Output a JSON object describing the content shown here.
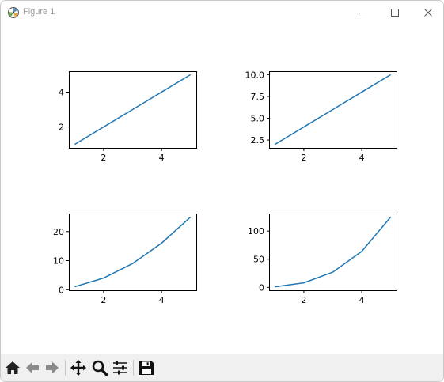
{
  "window": {
    "title": "Figure 1",
    "minimize_icon": "minimize-icon",
    "maximize_icon": "maximize-icon",
    "close_icon": "close-icon"
  },
  "toolbar": {
    "buttons": [
      {
        "name": "home",
        "icon": "home-icon"
      },
      {
        "name": "back",
        "icon": "back-arrow-icon"
      },
      {
        "name": "forward",
        "icon": "forward-arrow-icon"
      },
      {
        "name": "pan",
        "icon": "pan-move-icon"
      },
      {
        "name": "zoom",
        "icon": "zoom-magnifier-icon"
      },
      {
        "name": "configure-subplots",
        "icon": "sliders-icon"
      },
      {
        "name": "save",
        "icon": "floppy-save-icon"
      }
    ]
  },
  "colors": {
    "line": "#1f77b4",
    "toolbar_bg": "#f0f0f0",
    "axes": "#000000"
  },
  "chart_data": [
    {
      "type": "line",
      "x": [
        1,
        2,
        3,
        4,
        5
      ],
      "series": [
        {
          "values": [
            1,
            2,
            3,
            4,
            5
          ]
        }
      ],
      "xlim": [
        0.8,
        5.2
      ],
      "ylim": [
        0.8,
        5.2
      ],
      "xticks": [
        2,
        4
      ],
      "xticklabels": [
        "2",
        "4"
      ],
      "yticks": [
        2,
        4
      ],
      "yticklabels": [
        "2",
        "4"
      ],
      "title": "",
      "xlabel": "",
      "ylabel": "",
      "grid": false
    },
    {
      "type": "line",
      "x": [
        1,
        2,
        3,
        4,
        5
      ],
      "series": [
        {
          "values": [
            2,
            4,
            6,
            8,
            10
          ]
        }
      ],
      "xlim": [
        0.8,
        5.2
      ],
      "ylim": [
        1.6,
        10.4
      ],
      "xticks": [
        2,
        4
      ],
      "xticklabels": [
        "2",
        "4"
      ],
      "yticks": [
        2.5,
        5.0,
        7.5,
        10.0
      ],
      "yticklabels": [
        "2.5",
        "5.0",
        "7.5",
        "10.0"
      ],
      "title": "",
      "xlabel": "",
      "ylabel": "",
      "grid": false
    },
    {
      "type": "line",
      "x": [
        1,
        2,
        3,
        4,
        5
      ],
      "series": [
        {
          "values": [
            1,
            4,
            9,
            16,
            25
          ]
        }
      ],
      "xlim": [
        0.8,
        5.2
      ],
      "ylim": [
        -0.2,
        26.2
      ],
      "xticks": [
        2,
        4
      ],
      "xticklabels": [
        "2",
        "4"
      ],
      "yticks": [
        0,
        10,
        20
      ],
      "yticklabels": [
        "0",
        "10",
        "20"
      ],
      "title": "",
      "xlabel": "",
      "ylabel": "",
      "grid": false
    },
    {
      "type": "line",
      "x": [
        1,
        2,
        3,
        4,
        5
      ],
      "series": [
        {
          "values": [
            1,
            8,
            27,
            64,
            125
          ]
        }
      ],
      "xlim": [
        0.8,
        5.2
      ],
      "ylim": [
        -5.2,
        131.2
      ],
      "xticks": [
        2,
        4
      ],
      "xticklabels": [
        "2",
        "4"
      ],
      "yticks": [
        0,
        50,
        100
      ],
      "yticklabels": [
        "0",
        "50",
        "100"
      ],
      "title": "",
      "xlabel": "",
      "ylabel": "",
      "grid": false
    }
  ]
}
